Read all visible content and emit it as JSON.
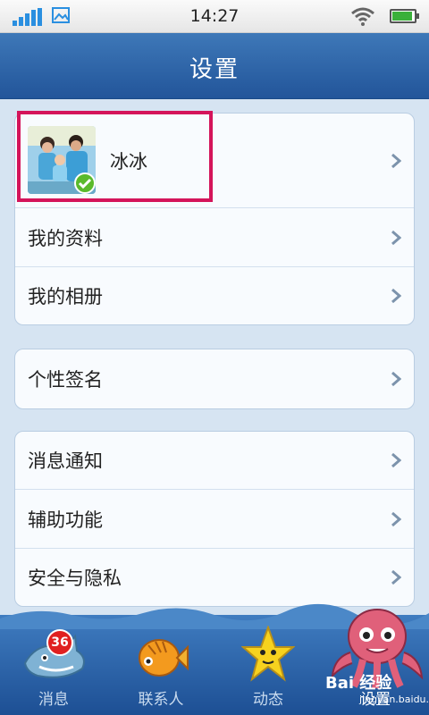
{
  "status_bar": {
    "time": "14:27",
    "battery_level": 0.9,
    "signal_bars": 4
  },
  "header": {
    "title": "设置"
  },
  "profile": {
    "name": "冰冰",
    "verified": true
  },
  "sections": [
    {
      "items": [
        {
          "label": "我的资料"
        },
        {
          "label": "我的相册"
        }
      ]
    },
    {
      "items": [
        {
          "label": "个性签名"
        }
      ]
    },
    {
      "items": [
        {
          "label": "消息通知"
        },
        {
          "label": "辅助功能"
        },
        {
          "label": "安全与隐私"
        }
      ]
    }
  ],
  "tabs": [
    {
      "label": "消息",
      "icon": "shark-icon",
      "badge": "36"
    },
    {
      "label": "联系人",
      "icon": "fish-icon"
    },
    {
      "label": "动态",
      "icon": "starfish-icon"
    },
    {
      "label": "设置",
      "icon": "octopus-icon",
      "active": true
    }
  ],
  "watermark": {
    "brand": "Bai 经验",
    "url": "jingyan.baidu.com"
  },
  "colors": {
    "accent": "#2a5e9f",
    "highlight": "#d4145a",
    "check": "#5aba2c"
  }
}
